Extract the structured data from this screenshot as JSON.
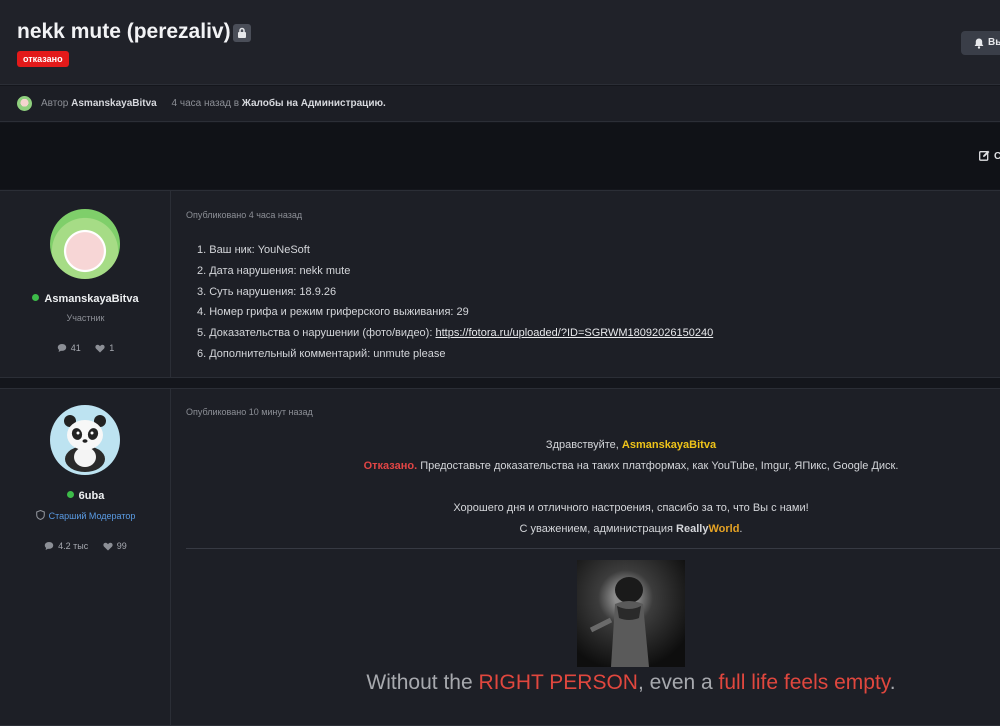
{
  "thread": {
    "title": "nekk mute (perezaliv)",
    "status_badge": "отказано",
    "watch_label": "Вы",
    "edit_label": "С"
  },
  "meta": {
    "author_prefix": "Автор",
    "author": "AsmanskayaBitva",
    "time": "4 часа назад",
    "in_text": "в",
    "forum": "Жалобы на Администрацию."
  },
  "posts": [
    {
      "username": "AsmanskayaBitva",
      "role": "Участник",
      "messages": "41",
      "reactions": "1",
      "posted": "Опубликовано 4 часа назад",
      "items": [
        "1. Ваш ник: YouNeSoft",
        "2. Дата нарушения: nekk mute",
        "3. Суть нарушения: 18.9.26",
        "4. Номер грифа и режим гриферского выживания: 29",
        "5. Доказательства о нарушении (фото/видео):",
        "6. Дополнительный комментарий: unmute please"
      ],
      "evidence_link": "https://fotora.ru/uploaded/?ID=SGRWM18092026150240"
    },
    {
      "username": "6uba",
      "role": "Старший Модератор",
      "messages": "4.2 тыс",
      "reactions": "99",
      "posted": "Опубликовано 10 минут назад",
      "greeting": "Здравствуйте,",
      "greeting_name": "AsmanskayaBitva",
      "denied": "Отказано.",
      "denied_text": "Предоставьте доказательства на таких платформах, как YouTube, Imgur, ЯПикс, Google Диск.",
      "wish": "Хорошего дня и отличного настроения, спасибо за то, что Вы с нами!",
      "regards": "С уважением, администрация",
      "brand_a": "Really",
      "brand_b": "World",
      "brand_end": ".",
      "quote_a": "Without the",
      "quote_b": "RIGHT PERSON",
      "quote_c": ", even a",
      "quote_d": "full life feels empty",
      "quote_e": "."
    }
  ],
  "colors": {
    "badge": "#e31a1a",
    "online": "#3dbb49",
    "highlight_yellow": "#f0c419",
    "highlight_red": "#e24545",
    "brand_orange": "#e6a324"
  }
}
